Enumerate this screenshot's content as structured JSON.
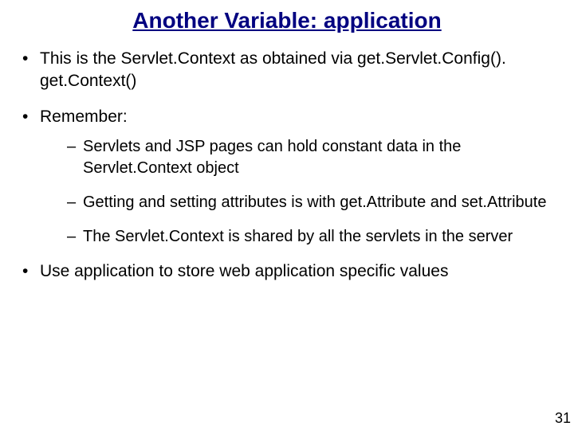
{
  "title": "Another Variable: application",
  "bullets": [
    {
      "text": "This is the Servlet.Context as obtained via get.Servlet.Config(). get.Context()"
    },
    {
      "text": "Remember:",
      "subs": [
        "Servlets and JSP pages can hold constant data in the Servlet.Context object",
        "Getting and setting attributes is with get.Attribute and set.Attribute",
        "The Servlet.Context is shared by all the servlets in the server"
      ]
    },
    {
      "text": "Use application to store web application specific values"
    }
  ],
  "pageNumber": "31"
}
